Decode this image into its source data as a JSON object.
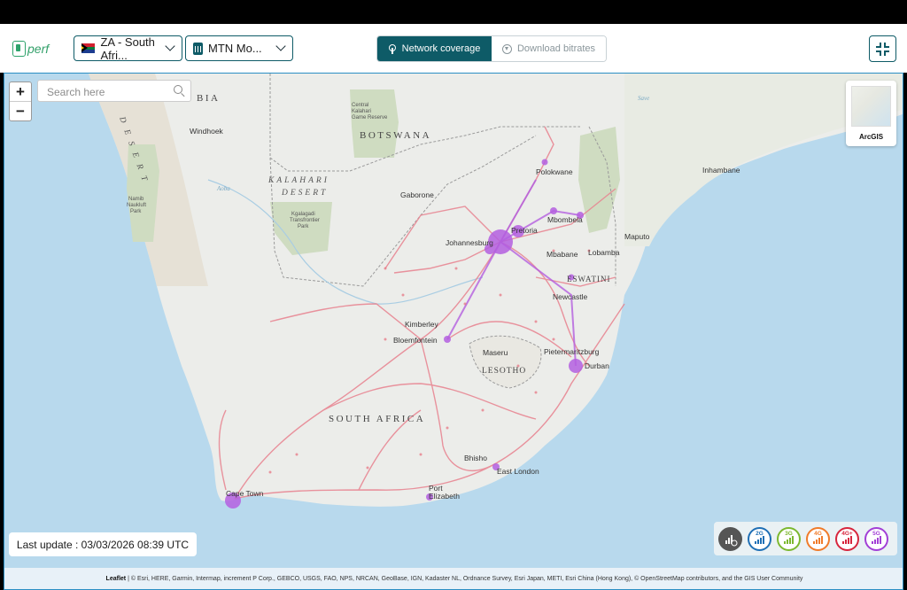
{
  "header": {
    "logo_text": "perf",
    "country_select": {
      "value": "ZA - South Afri..."
    },
    "operator_select": {
      "value": "MTN Mo..."
    },
    "view_toggle": {
      "active": "Network coverage",
      "inactive": "Download bitrates"
    }
  },
  "map": {
    "zoom_in": "+",
    "zoom_out": "−",
    "search": {
      "placeholder": "Search here",
      "value": ""
    },
    "basemap_label": "ArcGIS",
    "labels": {
      "countries": [
        "BOTSWANA",
        "SOUTH AFRICA",
        "LESOTHO",
        "ESWATINI",
        "BIA"
      ],
      "regions": [
        "KALAHARI",
        "DESERT",
        "D E S E R T"
      ],
      "cities": [
        "Windhoek",
        "Gaborone",
        "Pretoria",
        "Johannesburg",
        "Mbombela",
        "Mbabane",
        "Lobamba",
        "Maputo",
        "Inhambane",
        "Polokwane",
        "Newcastle",
        "Kimberley",
        "Bloemfontein",
        "Maseru",
        "Pietermaritzburg",
        "Durban",
        "Bhisho",
        "East London",
        "Port Elizabeth",
        "Cape Town"
      ],
      "parks": [
        "Central Kalahari Game Reserve",
        "Kgalagadi Transfrontier Park",
        "Namib Naukluft Park"
      ]
    },
    "last_update": "Last update : 03/03/2026 08:39 UTC",
    "legend": [
      {
        "label": "2G",
        "color": "#1f6fb5"
      },
      {
        "label": "3G",
        "color": "#7cb82f"
      },
      {
        "label": "4G",
        "color": "#f07b2a"
      },
      {
        "label": "4G+",
        "color": "#d7263d"
      },
      {
        "label": "5G",
        "color": "#a23fd6"
      }
    ],
    "attribution": {
      "leaflet": "Leaflet",
      "text": "| © Esri, HERE, Garmin, Intermap, increment P Corp., GEBCO, USGS, FAO, NPS, NRCAN, GeoBase, IGN, Kadaster NL, Ordnance Survey, Esri Japan, METI, Esri China (Hong Kong), © OpenStreetMap contributors, and the GIS User Community"
    }
  }
}
